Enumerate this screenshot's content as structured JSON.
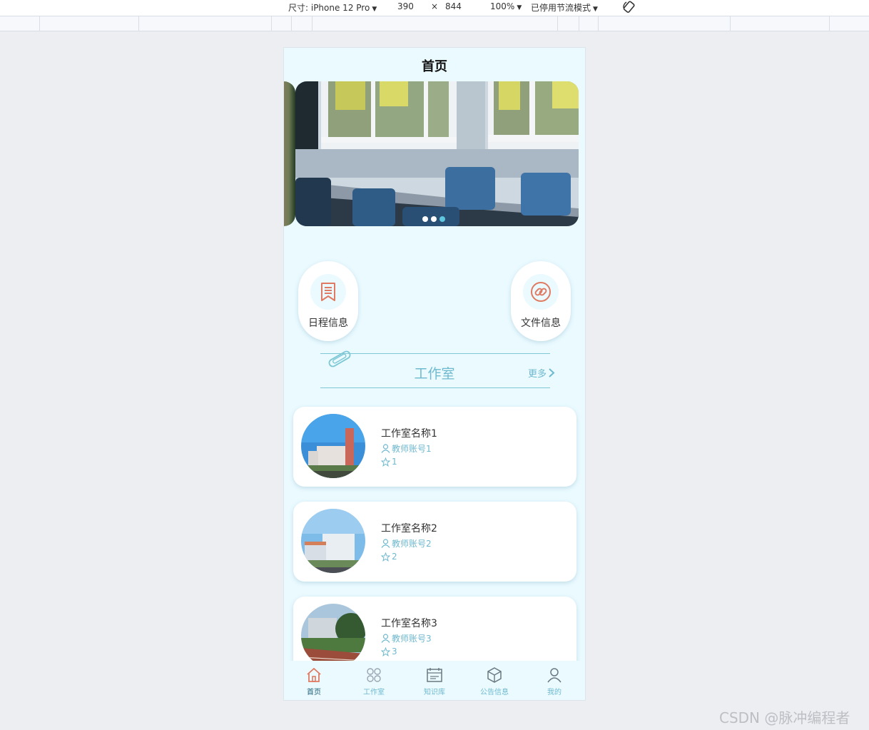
{
  "devtools": {
    "size_label": "尺寸: iPhone 12 Pro",
    "width": "390",
    "times": "×",
    "height": "844",
    "zoom": "100%",
    "throttle": "已停用节流模式"
  },
  "app": {
    "title": "首页",
    "carousel": {
      "slides": 3,
      "active_index": 2,
      "accent": "#5ec6dd"
    },
    "quick_entries": [
      {
        "label": "日程信息",
        "icon": "bookmark-doc-icon"
      },
      {
        "label": "文件信息",
        "icon": "link-icon"
      }
    ],
    "section": {
      "title": "工作室",
      "more": "更多"
    },
    "studios": [
      {
        "name": "工作室名称1",
        "teacher": "教师账号1",
        "favorites": "1"
      },
      {
        "name": "工作室名称2",
        "teacher": "教师账号2",
        "favorites": "2"
      },
      {
        "name": "工作室名称3",
        "teacher": "教师账号3",
        "favorites": "3"
      }
    ],
    "tabbar": [
      {
        "label": "首页",
        "icon": "home-icon",
        "active": true
      },
      {
        "label": "工作室",
        "icon": "grid-icon",
        "active": false
      },
      {
        "label": "知识库",
        "icon": "calendar-board-icon",
        "active": false
      },
      {
        "label": "公告信息",
        "icon": "box-icon",
        "active": false
      },
      {
        "label": "我的",
        "icon": "user-icon",
        "active": false
      }
    ],
    "colors": {
      "accent": "#6fb9cf",
      "icon_coral": "#e07a62",
      "background": "#eafaff"
    }
  },
  "watermark": "CSDN @脉冲编程者"
}
